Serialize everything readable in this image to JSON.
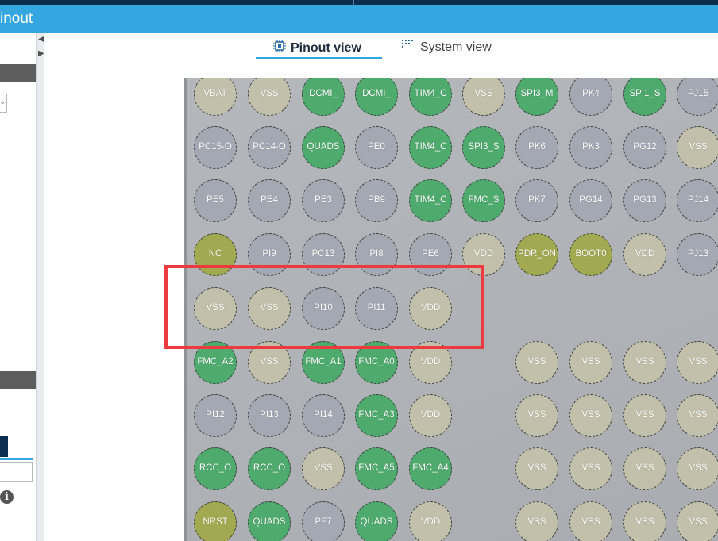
{
  "window": {
    "title": "inout"
  },
  "tabs": [
    {
      "label": "Pinout view",
      "active": true,
      "icon": "chip-icon"
    },
    {
      "label": "System view",
      "active": false,
      "icon": "system-grid-icon"
    }
  ],
  "colors": {
    "title_bar": "#35a7e0",
    "pin_gray": "#a3a8b3",
    "pin_beige": "#c2c0aa",
    "pin_green": "#4eaa6d",
    "pin_olive": "#a2a950",
    "highlight_box": "#ec3a3e"
  },
  "pins": [
    [
      "VBAT",
      "VSS",
      "DCMI_",
      "DCMI_",
      "TIM4_C",
      "VSS",
      "SPI3_M",
      "PK4",
      "SPI1_S",
      "PJ15"
    ],
    [
      "PC15-O",
      "PC14-O",
      "QUADS",
      "PE0",
      "TIM4_C",
      "SPI3_S",
      "PK6",
      "PK3",
      "PG12",
      "VSS"
    ],
    [
      "PE5",
      "PE4",
      "PE3",
      "PB9",
      "TIM4_C",
      "FMC_S",
      "PK7",
      "PG14",
      "PG13",
      "PJ14"
    ],
    [
      "NC",
      "PI9",
      "PC13",
      "PI8",
      "PE6",
      "VDD",
      "PDR_ON",
      "BOOT0",
      "VDD",
      "PJ13"
    ],
    [
      "VSS",
      "VSS",
      "PI10",
      "PI11",
      "VDD",
      "",
      "",
      "",
      "",
      ""
    ],
    [
      "FMC_A2",
      "VSS",
      "FMC_A1",
      "FMC_A0",
      "VDD",
      "",
      "VSS",
      "VSS",
      "VSS",
      "VSS"
    ],
    [
      "PI12",
      "PI13",
      "PI14",
      "FMC_A3",
      "VDD",
      "",
      "VSS",
      "VSS",
      "VSS",
      "VSS"
    ],
    [
      "RCC_O",
      "RCC_O",
      "VSS",
      "FMC_A5",
      "FMC_A4",
      "",
      "VSS",
      "VSS",
      "VSS",
      "VSS"
    ],
    [
      "NRST",
      "QUADS",
      "PF7",
      "QUADS",
      "VDD",
      "",
      "VSS",
      "VSS",
      "VSS",
      "VSS"
    ]
  ],
  "pin_colors": [
    [
      "beige",
      "beige",
      "green",
      "green",
      "green",
      "beige",
      "green",
      "gray",
      "green",
      "gray"
    ],
    [
      "gray",
      "gray",
      "green",
      "gray",
      "green",
      "green",
      "gray",
      "gray",
      "gray",
      "beige"
    ],
    [
      "gray",
      "gray",
      "gray",
      "gray",
      "green",
      "green",
      "gray",
      "gray",
      "gray",
      "gray"
    ],
    [
      "olive",
      "gray",
      "gray",
      "gray",
      "gray",
      "beige",
      "olive",
      "olive",
      "beige",
      "gray"
    ],
    [
      "beige",
      "beige",
      "gray",
      "gray",
      "beige",
      "",
      "",
      "",
      "",
      ""
    ],
    [
      "green",
      "beige",
      "green",
      "green",
      "beige",
      "",
      "beige",
      "beige",
      "beige",
      "beige"
    ],
    [
      "gray",
      "gray",
      "gray",
      "green",
      "beige",
      "",
      "beige",
      "beige",
      "beige",
      "beige"
    ],
    [
      "green",
      "green",
      "beige",
      "green",
      "green",
      "",
      "beige",
      "beige",
      "beige",
      "beige"
    ],
    [
      "olive",
      "green",
      "gray",
      "green",
      "beige",
      "",
      "beige",
      "beige",
      "beige",
      "beige"
    ]
  ]
}
